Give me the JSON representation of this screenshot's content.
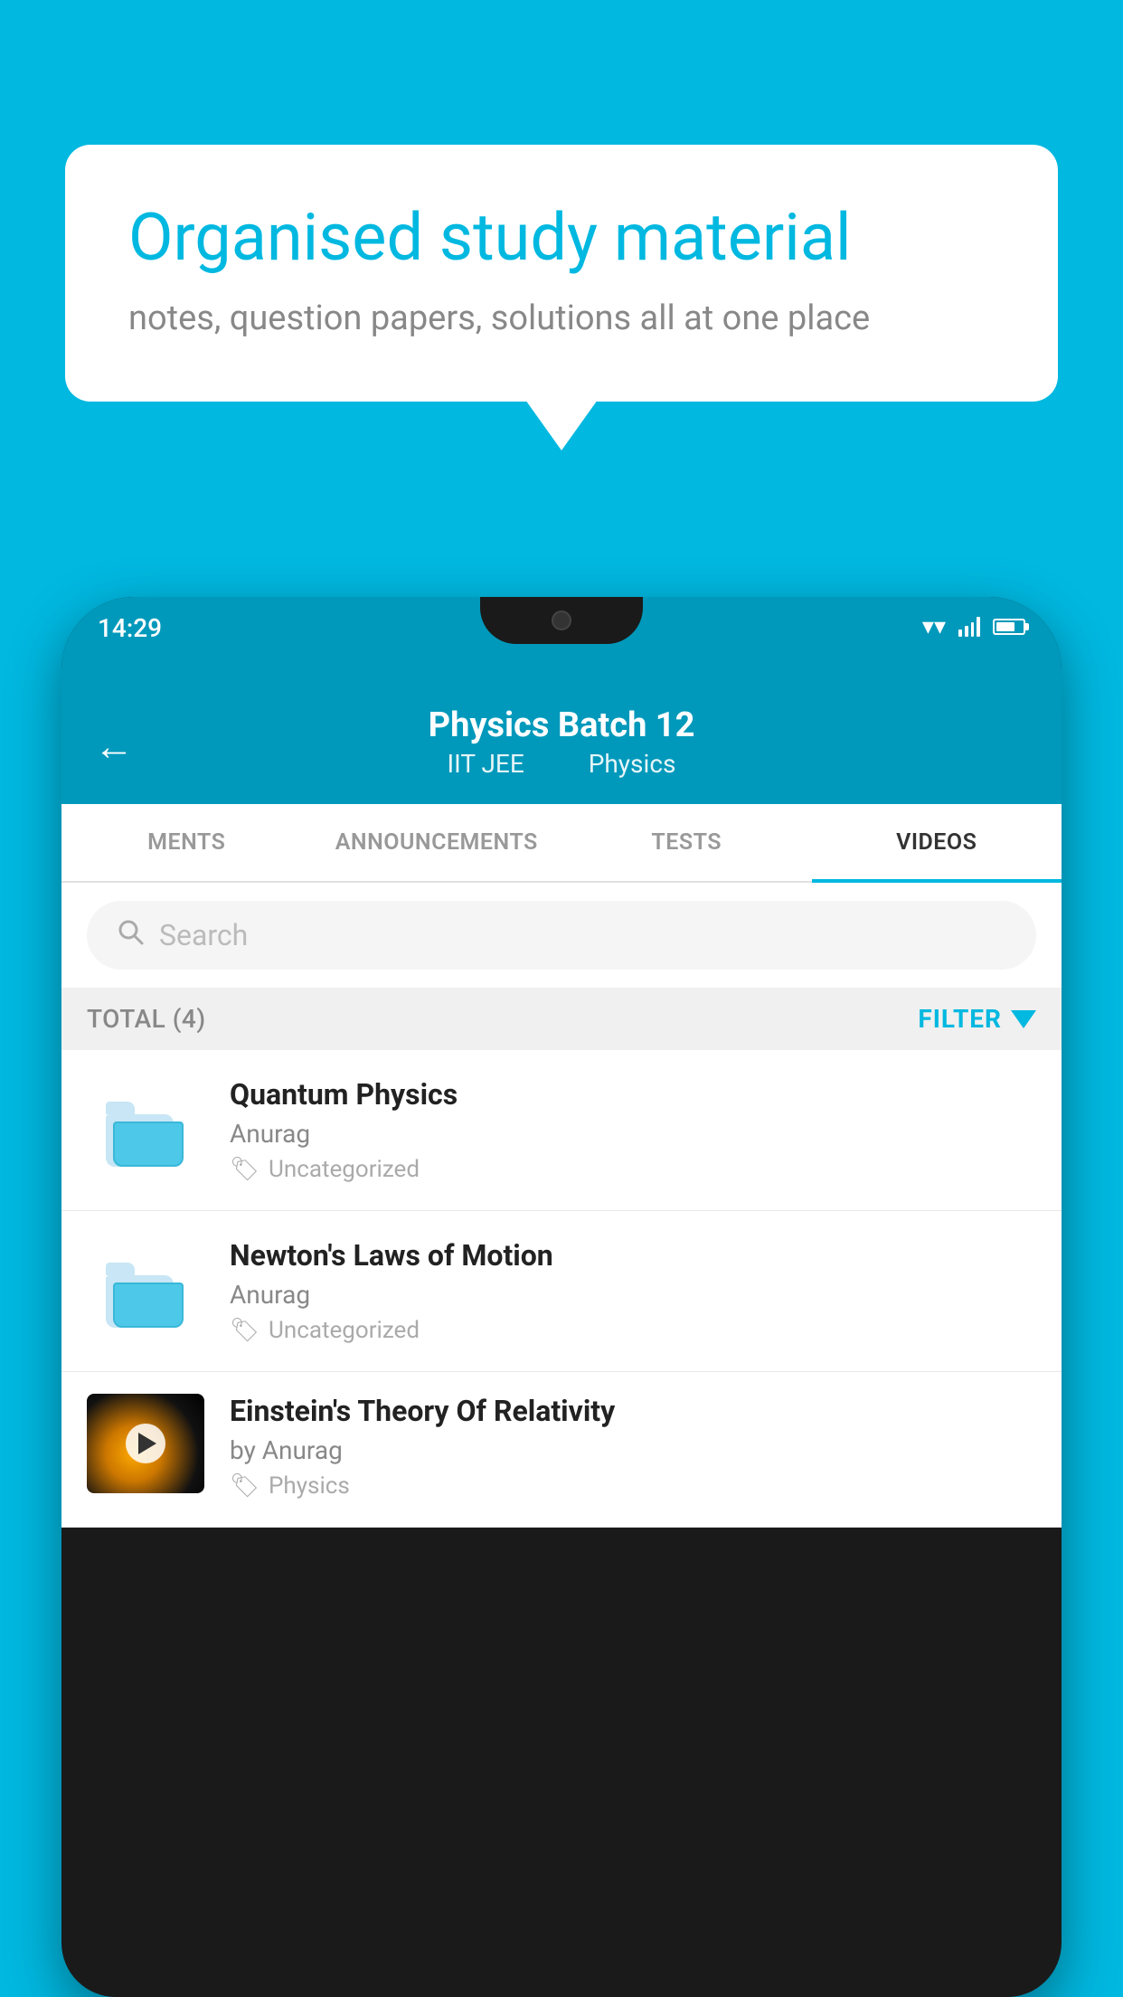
{
  "background": {
    "color": "#00b8e0"
  },
  "speech_bubble": {
    "title": "Organised study material",
    "subtitle": "notes, question papers, solutions all at one place"
  },
  "status_bar": {
    "time": "14:29"
  },
  "app_header": {
    "title": "Physics Batch 12",
    "subtitle_left": "IIT JEE",
    "subtitle_right": "Physics",
    "back_label": "←"
  },
  "tabs": [
    {
      "label": "MENTS",
      "active": false
    },
    {
      "label": "ANNOUNCEMENTS",
      "active": false
    },
    {
      "label": "TESTS",
      "active": false
    },
    {
      "label": "VIDEOS",
      "active": true
    }
  ],
  "search": {
    "placeholder": "Search"
  },
  "filter_bar": {
    "total_label": "TOTAL (4)",
    "filter_label": "FILTER"
  },
  "video_items": [
    {
      "title": "Quantum Physics",
      "author": "Anurag",
      "tag": "Uncategorized",
      "has_thumbnail": false
    },
    {
      "title": "Newton's Laws of Motion",
      "author": "Anurag",
      "tag": "Uncategorized",
      "has_thumbnail": false
    },
    {
      "title": "Einstein's Theory Of Relativity",
      "author": "by Anurag",
      "tag": "Physics",
      "has_thumbnail": true
    }
  ]
}
